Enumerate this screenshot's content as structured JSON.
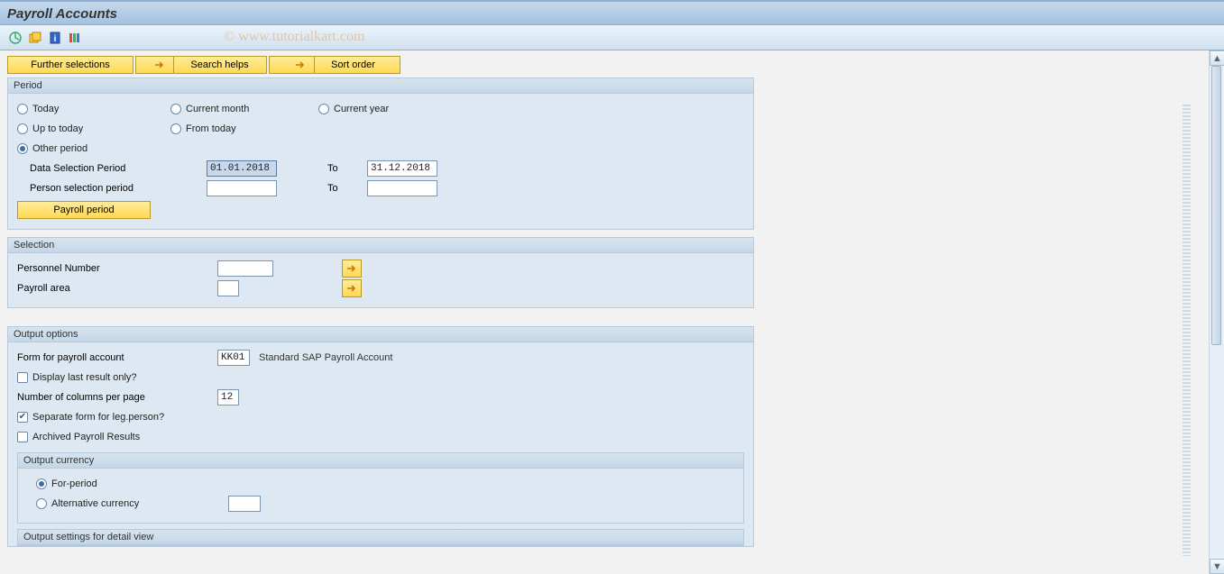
{
  "title": "Payroll Accounts",
  "watermark": "© www.tutorialkart.com",
  "topButtons": {
    "further": "Further selections",
    "search": "Search helps",
    "sort": "Sort order"
  },
  "period": {
    "title": "Period",
    "radios": {
      "today": "Today",
      "upto": "Up to today",
      "other": "Other period",
      "curMonth": "Current month",
      "fromToday": "From today",
      "curYear": "Current year"
    },
    "dataSelLabel": "Data Selection Period",
    "dataSelFrom": "01.01.2018",
    "dataSelTo": "31.12.2018",
    "personSelLabel": "Person selection period",
    "personSelFrom": "",
    "personSelTo": "",
    "toLabel": "To",
    "payrollPeriodBtn": "Payroll period"
  },
  "selection": {
    "title": "Selection",
    "personnelLabel": "Personnel Number",
    "personnelValue": "",
    "payrollAreaLabel": "Payroll area",
    "payrollAreaValue": ""
  },
  "output": {
    "title": "Output options",
    "formLabel": "Form for payroll account",
    "formValue": "KK01",
    "formDesc": "Standard SAP Payroll Account",
    "displayLast": "Display last result only?",
    "colsLabel": "Number of columns per page",
    "colsValue": "12",
    "sepForm": "Separate form for leg.person?",
    "archived": "Archived Payroll Results",
    "currency": {
      "title": "Output currency",
      "forPeriod": "For-period",
      "alt": "Alternative currency",
      "altValue": ""
    },
    "detailTitle": "Output settings for detail view"
  }
}
